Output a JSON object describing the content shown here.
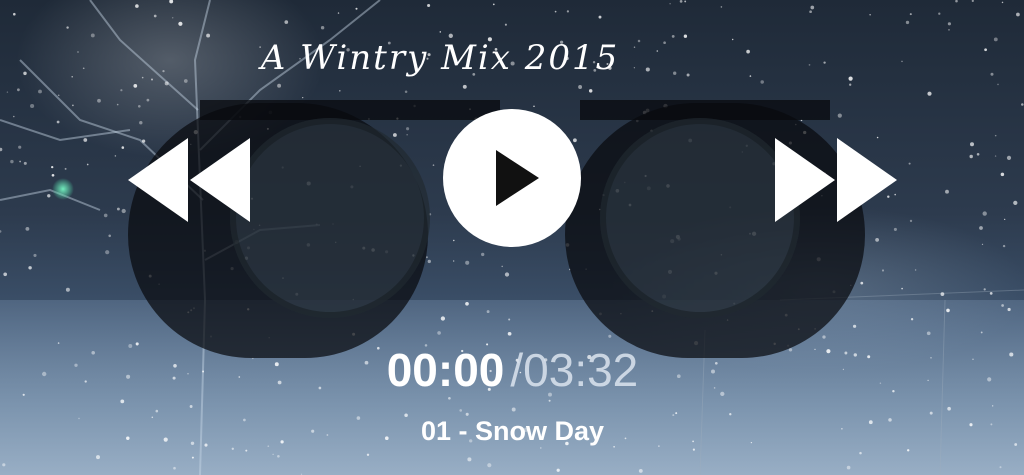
{
  "mixtape": {
    "title": "A Wintry Mix 2015"
  },
  "controls": {
    "rewind_icon": "rewind-icon",
    "play_icon": "play-icon",
    "forward_icon": "fast-forward-icon"
  },
  "player": {
    "current_time": "00:00",
    "total_time": "/03:32",
    "track": "01 - Snow Day",
    "progress": 0
  },
  "colors": {
    "controls": "#ffffff",
    "reel_shell": "#08090e"
  }
}
